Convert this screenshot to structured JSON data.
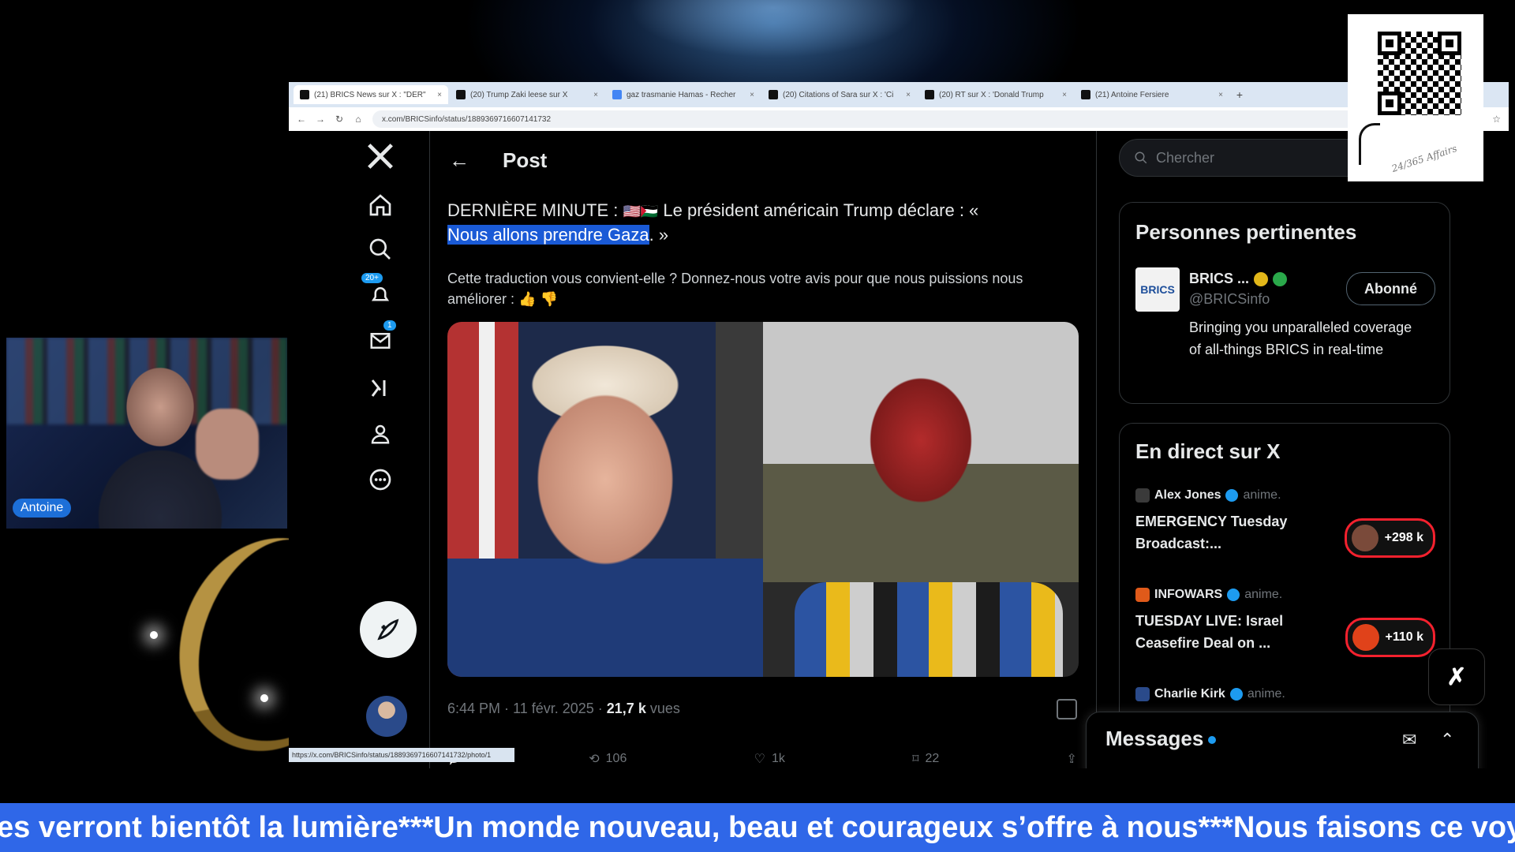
{
  "browser": {
    "tabs": [
      {
        "label": "(21) BRICS News sur X : \"DER\"",
        "active": true
      },
      {
        "label": "(20) Trump Zaki leese sur X",
        "active": false
      },
      {
        "label": "gaz trasmanie Hamas - Recher",
        "active": false
      },
      {
        "label": "(20) Citations of Sara sur X : 'Ci",
        "active": false
      },
      {
        "label": "(20) RT sur X : 'Donald Trump",
        "active": false
      },
      {
        "label": "(21) Antoine Fersiere",
        "active": false
      }
    ],
    "url": "x.com/BRICSinfo/status/1889369716607141732"
  },
  "nav": {
    "notifications_badge": "20+",
    "messages_badge": "1",
    "icons": [
      "x-logo-icon",
      "home-icon",
      "search-icon",
      "bell-icon",
      "mail-icon",
      "grok-icon",
      "profile-icon",
      "more-icon"
    ]
  },
  "post": {
    "back_arrow": "←",
    "header_title": "Post",
    "text_before": "DERNIÈRE MINUTE : ",
    "flags": "🇺🇸🇵🇸",
    "text_after": " Le président américain Trump déclare : «",
    "text_highlight": "Nous allons prendre Gaza",
    "text_end": ". »",
    "translation_prompt": "Cette traduction vous convient-elle ? Donnez-nous votre avis pour que nous puissions nous améliorer :",
    "time": "6:44 PM · 11 févr. 2025 · ",
    "views_count": "21,7 k",
    "views_label": " vues",
    "retweets": "106",
    "likes": "1k",
    "bookmarks": "22",
    "status_url": "https://x.com/BRICSinfo/status/1889369716607141732/photo/1"
  },
  "sidebar": {
    "search_placeholder": "Chercher",
    "relevant_title": "Personnes pertinentes",
    "person": {
      "name": "BRICS ...",
      "handle": "@BRICSinfo",
      "follow_label": "Abonné",
      "bio": "Bringing you unparalleled coverage of all-things BRICS in real-time",
      "logo_text": "BRICS"
    },
    "live_title": "En direct sur X",
    "live": [
      {
        "host": "Alex Jones",
        "role": "anime.",
        "title": "EMERGENCY Tuesday Broadcast:...",
        "count": "+298 k",
        "host_color": "#3a3a3a"
      },
      {
        "host": "INFOWARS",
        "role": "anime.",
        "title": "TUESDAY LIVE: Israel Ceasefire Deal on ...",
        "count": "+110 k",
        "host_color": "#e05a1a"
      },
      {
        "host": "Charlie Kirk",
        "role": "anime.",
        "title": "",
        "count": "",
        "host_color": "#2a4a8a"
      }
    ],
    "messages_label": "Messages"
  },
  "overlay": {
    "cam_name": "Antoine",
    "qr_signature": "24/365 Affairs",
    "ticker": "es verront bientôt la lumière***Un monde nouveau, beau et courageux s’offre à nous***Nous faisons ce voya"
  }
}
